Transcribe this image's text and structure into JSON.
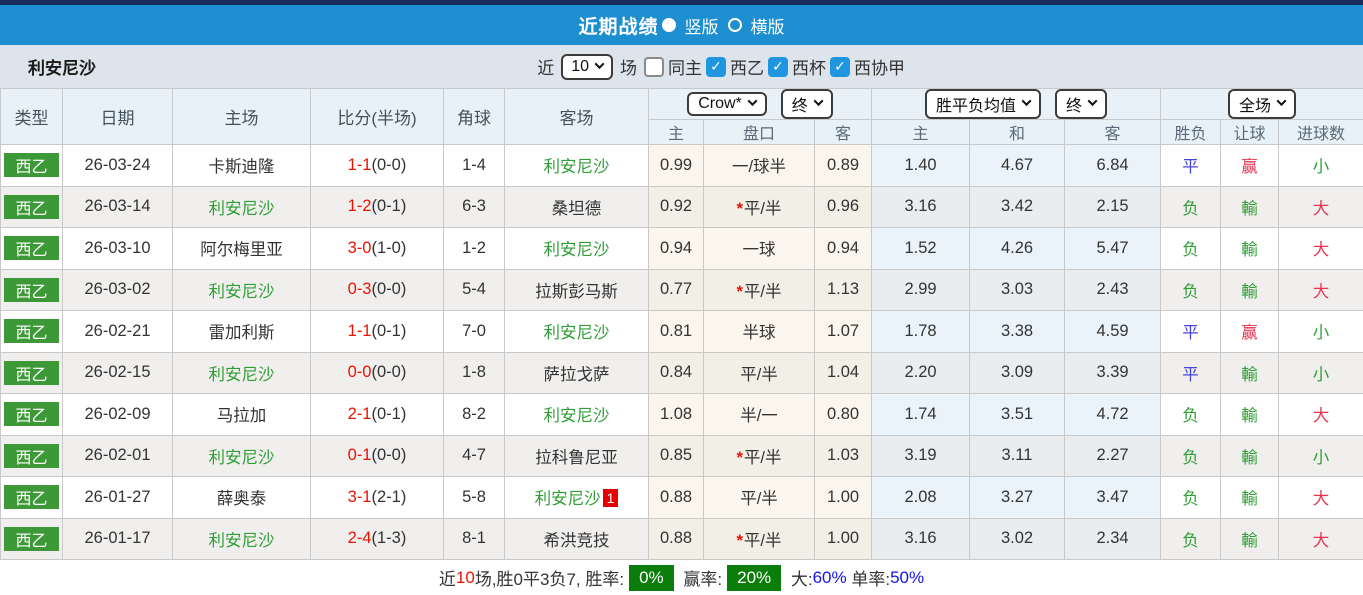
{
  "title_bar": {
    "title": "近期战绩",
    "radios": [
      {
        "label": "竖版",
        "selected": true
      },
      {
        "label": "横版",
        "selected": false
      }
    ]
  },
  "filter_bar": {
    "team": "利安尼沙",
    "near_label": "近",
    "near_value": "10",
    "games_label": "场",
    "checkboxes": [
      {
        "label": "同主",
        "checked": false
      },
      {
        "label": "西乙",
        "checked": true
      },
      {
        "label": "西杯",
        "checked": true
      },
      {
        "label": "西协甲",
        "checked": true
      }
    ]
  },
  "table": {
    "static_headers": [
      "类型",
      "日期",
      "主场",
      "比分(半场)",
      "角球",
      "客场"
    ],
    "groups": {
      "crow": {
        "dropdown1": "Crow*",
        "dropdown2": "终",
        "subs": [
          "主",
          "盘口",
          "客"
        ]
      },
      "avg": {
        "dropdown1": "胜平负均值",
        "dropdown2": "终",
        "subs": [
          "主",
          "和",
          "客"
        ]
      },
      "full": {
        "dropdown": "全场",
        "subs": [
          "胜负",
          "让球",
          "进球数"
        ]
      }
    },
    "rows": [
      {
        "type": "西乙",
        "date": "26-03-24",
        "home": "卡斯迪隆",
        "home_green": false,
        "score": "1-1",
        "half": "(0-0)",
        "corners": "1-4",
        "away": "利安尼沙",
        "away_green": true,
        "away_badge": "",
        "crow_home": "0.99",
        "handicap": "一/球半",
        "handicap_star": false,
        "crow_away": "0.89",
        "avg_home": "1.40",
        "avg_draw": "4.67",
        "avg_away": "6.84",
        "result": {
          "text": "平",
          "color": "blue"
        },
        "handicap_result": {
          "text": "赢",
          "color": "red"
        },
        "goals": {
          "text": "小",
          "color": "green"
        }
      },
      {
        "type": "西乙",
        "date": "26-03-14",
        "home": "利安尼沙",
        "home_green": true,
        "score": "1-2",
        "half": "(0-1)",
        "corners": "6-3",
        "away": "桑坦德",
        "away_green": false,
        "away_badge": "",
        "crow_home": "0.92",
        "handicap": "平/半",
        "handicap_star": true,
        "crow_away": "0.96",
        "avg_home": "3.16",
        "avg_draw": "3.42",
        "avg_away": "2.15",
        "result": {
          "text": "负",
          "color": "green"
        },
        "handicap_result": {
          "text": "輸",
          "color": "green"
        },
        "goals": {
          "text": "大",
          "color": "red"
        }
      },
      {
        "type": "西乙",
        "date": "26-03-10",
        "home": "阿尔梅里亚",
        "home_green": false,
        "score": "3-0",
        "half": "(1-0)",
        "corners": "1-2",
        "away": "利安尼沙",
        "away_green": true,
        "away_badge": "",
        "crow_home": "0.94",
        "handicap": "一球",
        "handicap_star": false,
        "crow_away": "0.94",
        "avg_home": "1.52",
        "avg_draw": "4.26",
        "avg_away": "5.47",
        "result": {
          "text": "负",
          "color": "green"
        },
        "handicap_result": {
          "text": "輸",
          "color": "green"
        },
        "goals": {
          "text": "大",
          "color": "red"
        }
      },
      {
        "type": "西乙",
        "date": "26-03-02",
        "home": "利安尼沙",
        "home_green": true,
        "score": "0-3",
        "half": "(0-0)",
        "corners": "5-4",
        "away": "拉斯彭马斯",
        "away_green": false,
        "away_badge": "",
        "crow_home": "0.77",
        "handicap": "平/半",
        "handicap_star": true,
        "crow_away": "1.13",
        "avg_home": "2.99",
        "avg_draw": "3.03",
        "avg_away": "2.43",
        "result": {
          "text": "负",
          "color": "green"
        },
        "handicap_result": {
          "text": "輸",
          "color": "green"
        },
        "goals": {
          "text": "大",
          "color": "red"
        }
      },
      {
        "type": "西乙",
        "date": "26-02-21",
        "home": "雷加利斯",
        "home_green": false,
        "score": "1-1",
        "half": "(0-1)",
        "corners": "7-0",
        "away": "利安尼沙",
        "away_green": true,
        "away_badge": "",
        "crow_home": "0.81",
        "handicap": "半球",
        "handicap_star": false,
        "crow_away": "1.07",
        "avg_home": "1.78",
        "avg_draw": "3.38",
        "avg_away": "4.59",
        "result": {
          "text": "平",
          "color": "blue"
        },
        "handicap_result": {
          "text": "赢",
          "color": "red"
        },
        "goals": {
          "text": "小",
          "color": "green"
        }
      },
      {
        "type": "西乙",
        "date": "26-02-15",
        "home": "利安尼沙",
        "home_green": true,
        "score": "0-0",
        "half": "(0-0)",
        "corners": "1-8",
        "away": "萨拉戈萨",
        "away_green": false,
        "away_badge": "",
        "crow_home": "0.84",
        "handicap": "平/半",
        "handicap_star": false,
        "crow_away": "1.04",
        "avg_home": "2.20",
        "avg_draw": "3.09",
        "avg_away": "3.39",
        "result": {
          "text": "平",
          "color": "blue"
        },
        "handicap_result": {
          "text": "輸",
          "color": "green"
        },
        "goals": {
          "text": "小",
          "color": "green"
        }
      },
      {
        "type": "西乙",
        "date": "26-02-09",
        "home": "马拉加",
        "home_green": false,
        "score": "2-1",
        "half": "(0-1)",
        "corners": "8-2",
        "away": "利安尼沙",
        "away_green": true,
        "away_badge": "",
        "crow_home": "1.08",
        "handicap": "半/一",
        "handicap_star": false,
        "crow_away": "0.80",
        "avg_home": "1.74",
        "avg_draw": "3.51",
        "avg_away": "4.72",
        "result": {
          "text": "负",
          "color": "green"
        },
        "handicap_result": {
          "text": "輸",
          "color": "green"
        },
        "goals": {
          "text": "大",
          "color": "red"
        }
      },
      {
        "type": "西乙",
        "date": "26-02-01",
        "home": "利安尼沙",
        "home_green": true,
        "score": "0-1",
        "half": "(0-0)",
        "corners": "4-7",
        "away": "拉科鲁尼亚",
        "away_green": false,
        "away_badge": "",
        "crow_home": "0.85",
        "handicap": "平/半",
        "handicap_star": true,
        "crow_away": "1.03",
        "avg_home": "3.19",
        "avg_draw": "3.11",
        "avg_away": "2.27",
        "result": {
          "text": "负",
          "color": "green"
        },
        "handicap_result": {
          "text": "輸",
          "color": "green"
        },
        "goals": {
          "text": "小",
          "color": "green"
        }
      },
      {
        "type": "西乙",
        "date": "26-01-27",
        "home": "薛奥泰",
        "home_green": false,
        "score": "3-1",
        "half": "(2-1)",
        "corners": "5-8",
        "away": "利安尼沙",
        "away_green": true,
        "away_badge": "1",
        "crow_home": "0.88",
        "handicap": "平/半",
        "handicap_star": false,
        "crow_away": "1.00",
        "avg_home": "2.08",
        "avg_draw": "3.27",
        "avg_away": "3.47",
        "result": {
          "text": "负",
          "color": "green"
        },
        "handicap_result": {
          "text": "輸",
          "color": "green"
        },
        "goals": {
          "text": "大",
          "color": "red"
        }
      },
      {
        "type": "西乙",
        "date": "26-01-17",
        "home": "利安尼沙",
        "home_green": true,
        "score": "2-4",
        "half": "(1-3)",
        "corners": "8-1",
        "away": "希洪竞技",
        "away_green": false,
        "away_badge": "",
        "crow_home": "0.88",
        "handicap": "平/半",
        "handicap_star": true,
        "crow_away": "1.00",
        "avg_home": "3.16",
        "avg_draw": "3.02",
        "avg_away": "2.34",
        "result": {
          "text": "负",
          "color": "green"
        },
        "handicap_result": {
          "text": "輸",
          "color": "green"
        },
        "goals": {
          "text": "大",
          "color": "red"
        }
      }
    ]
  },
  "summary": {
    "segments": [
      {
        "text": "近",
        "style": "plain"
      },
      {
        "text": "10",
        "style": "red"
      },
      {
        "text": "场,胜0平3负7, 胜率:",
        "style": "plain"
      },
      {
        "text": "0%",
        "style": "badge"
      },
      {
        "text": " 赢率:",
        "style": "plain"
      },
      {
        "text": "20%",
        "style": "badge"
      },
      {
        "text": " 大:",
        "style": "plain"
      },
      {
        "text": "60%",
        "style": "blue"
      },
      {
        "text": " 单率:",
        "style": "plain"
      },
      {
        "text": "50%",
        "style": "blue"
      }
    ]
  },
  "colors": {
    "accent_blue": "#1d8ecf",
    "top_stripe": "#1b2b5c",
    "type_green": "#3d9837",
    "team_green": "#2f9e35",
    "score_red": "#ee1100",
    "result_blue": "#4444d9",
    "result_green": "#2f9e35",
    "result_red": "#e8344e",
    "badge_green": "#0a7d0a",
    "summary_blue": "#1414e6"
  }
}
